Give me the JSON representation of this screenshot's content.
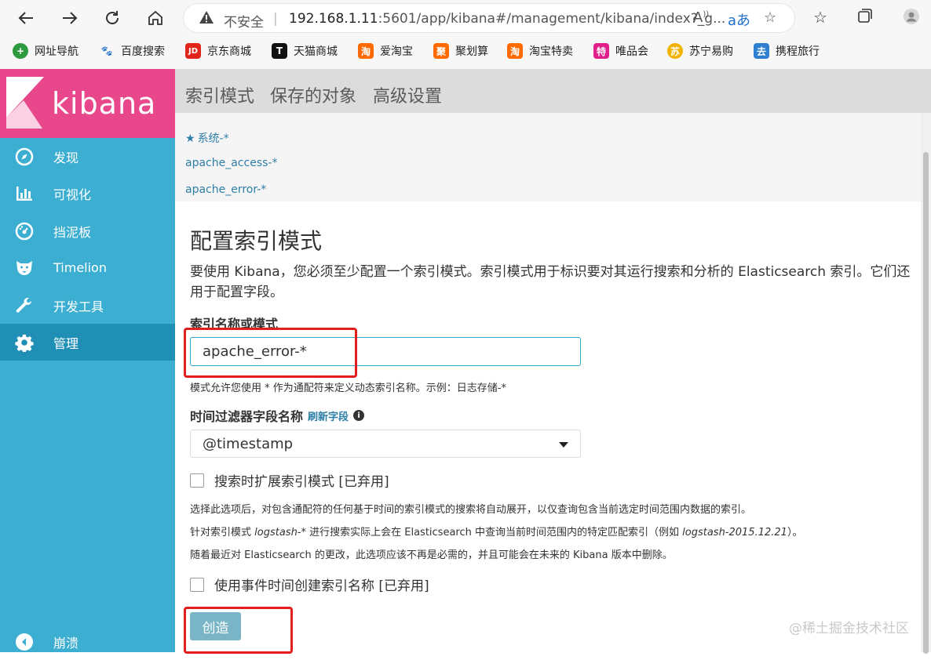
{
  "browser": {
    "security_label": "不安全",
    "separator": "|",
    "url_host": "192.168.1.11",
    "url_rest": ":5601/app/kibana#/management/kibana/index?_g...",
    "bookmarks": [
      {
        "label": "网址导航",
        "color": "#2e9a3f",
        "glyph": "+"
      },
      {
        "label": "百度搜索",
        "color": "#2e5fd1",
        "glyph": "🐾"
      },
      {
        "label": "京东商城",
        "color": "#e1251b",
        "glyph": "JD"
      },
      {
        "label": "天猫商城",
        "color": "#111111",
        "glyph": "T"
      },
      {
        "label": "爱淘宝",
        "color": "#ff6a00",
        "glyph": "淘"
      },
      {
        "label": "聚划算",
        "color": "#ff6a00",
        "glyph": "聚"
      },
      {
        "label": "淘宝特卖",
        "color": "#ff6a00",
        "glyph": "淘"
      },
      {
        "label": "唯品会",
        "color": "#e01f8b",
        "glyph": "特"
      },
      {
        "label": "苏宁易购",
        "color": "#f2b300",
        "glyph": "苏"
      },
      {
        "label": "携程旅行",
        "color": "#2f7fd0",
        "glyph": "去"
      }
    ]
  },
  "sidebar": {
    "brand": "kibana",
    "items": [
      {
        "label": "发现",
        "icon": "compass-icon"
      },
      {
        "label": "可视化",
        "icon": "bar-chart-icon"
      },
      {
        "label": "挡泥板",
        "icon": "dashboard-icon"
      },
      {
        "label": "Timelion",
        "icon": "timelion-icon"
      },
      {
        "label": "开发工具",
        "icon": "wrench-icon"
      },
      {
        "label": "管理",
        "icon": "gear-icon",
        "active": true
      }
    ],
    "collapse_label": "崩溃"
  },
  "management": {
    "tabs": [
      "索引模式",
      "保存的对象",
      "高级设置"
    ],
    "patterns": [
      "系统-*",
      "apache_access-*",
      "apache_error-*"
    ]
  },
  "form": {
    "title": "配置索引模式",
    "description": "要使用 Kibana，您必须至少配置一个索引模式。索引模式用于标识要对其运行搜索和分析的 Elasticsearch 索引。它们还用于配置字段。",
    "index_label": "索引名称或模式",
    "index_value": "apache_error-*",
    "index_help": "模式允许您使用 * 作为通配符来定义动态索引名称。示例：日志存储-*",
    "time_label": "时间过滤器字段名称",
    "refresh_label": "刷新字段",
    "time_value": "@timestamp",
    "expand_label": "搜索时扩展索引模式 [已弃用]",
    "note1": "选择此选项后，对包含通配符的任何基于时间的索引模式的搜索将自动展开，以仅查询包含当前选定时间范围内数据的索引。",
    "note2_a": "针对索引模式 ",
    "note2_b": "logstash-*",
    "note2_c": " 进行搜索实际上会在 Elasticsearch 中查询当前时间范围内的特定匹配索引（例如 ",
    "note2_d": "logstash-2015.12.21",
    "note2_e": "）。",
    "note3": "随着最近对 Elasticsearch 的更改，此选项应该不再是必需的，并且可能会在未来的 Kibana 版本中删除。",
    "event_time_label": "使用事件时间创建索引名称 [已弃用]",
    "create_label": "创造"
  },
  "watermark": "@稀土掘金技术社区"
}
